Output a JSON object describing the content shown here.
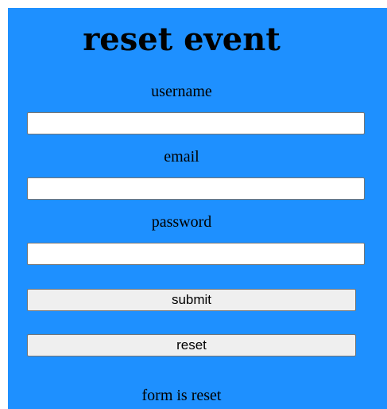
{
  "page": {
    "title": "reset event",
    "background_color": "#1e90ff"
  },
  "form": {
    "username_label": "username",
    "username_value": "",
    "email_label": "email",
    "email_value": "",
    "password_label": "password",
    "password_value": "",
    "submit_label": "submit",
    "reset_label": "reset"
  },
  "status": {
    "message": "form is reset"
  }
}
